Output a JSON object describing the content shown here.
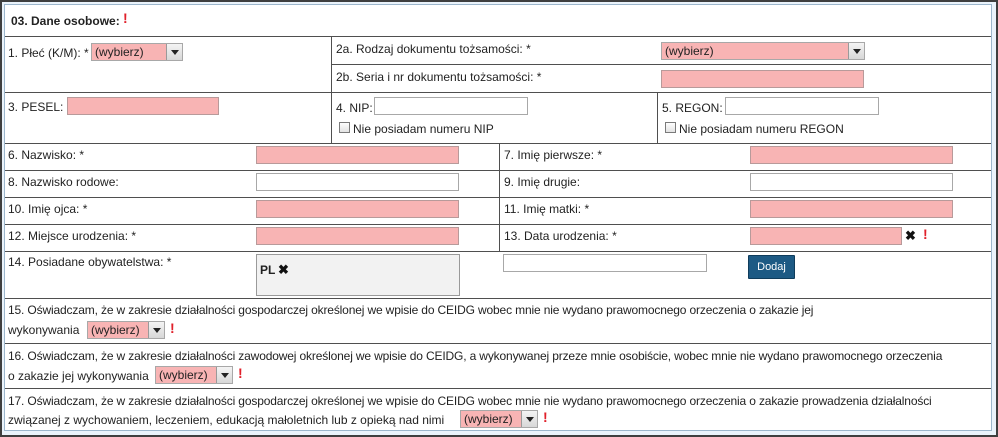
{
  "section": {
    "title": "03. Dane osobowe:",
    "required_mark": "!"
  },
  "fields": {
    "plec": {
      "label": "1. Płeć (K/M): *",
      "value": "(wybierz)"
    },
    "rodzaj_dok": {
      "label": "2a. Rodzaj dokumentu tożsamości: *",
      "value": "(wybierz)"
    },
    "seria_nr": {
      "label": "2b. Seria i nr dokumentu tożsamości: *",
      "value": ""
    },
    "pesel": {
      "label": "3. PESEL:",
      "value": ""
    },
    "nip": {
      "label": "4. NIP:",
      "value": "",
      "checkbox_label": "Nie posiadam numeru NIP"
    },
    "regon": {
      "label": "5. REGON:",
      "value": "",
      "checkbox_label": "Nie posiadam numeru REGON"
    },
    "nazwisko": {
      "label": "6. Nazwisko: *",
      "value": ""
    },
    "imie_pierwsze": {
      "label": "7. Imię pierwsze: *",
      "value": ""
    },
    "nazwisko_rodowe": {
      "label": "8. Nazwisko rodowe:",
      "value": ""
    },
    "imie_drugie": {
      "label": "9. Imię drugie:",
      "value": ""
    },
    "imie_ojca": {
      "label": "10. Imię ojca: *",
      "value": ""
    },
    "imie_matki": {
      "label": "11. Imię matki: *",
      "value": ""
    },
    "miejsce_urodzenia": {
      "label": "12. Miejsce urodzenia: *",
      "value": ""
    },
    "data_urodzenia": {
      "label": "13. Data urodzenia: *",
      "value": ""
    },
    "obywatelstwa": {
      "label": "14. Posiadane obywatelstwa: *",
      "item": "PL",
      "input_value": "",
      "add_button": "Dodaj"
    }
  },
  "statements": {
    "s15": {
      "line1": "15. Oświadczam, że w zakresie działalności gospodarczej określonej we wpisie do CEIDG wobec mnie nie wydano prawomocnego orzeczenia o zakazie jej",
      "line2": "wykonywania",
      "value": "(wybierz)"
    },
    "s16": {
      "line1": "16. Oświadczam, że w zakresie działalności zawodowej określonej we wpisie do CEIDG, a wykonywanej przeze mnie osobiście, wobec mnie nie wydano prawomocnego orzeczenia",
      "line2": "o zakazie jej wykonywania",
      "value": "(wybierz)"
    },
    "s17": {
      "line1": "17. Oświadczam, że w zakresie działalności gospodarczej określonej we wpisie do CEIDG wobec mnie nie wydano prawomocnego orzeczenia o zakazie prowadzenia działalności",
      "line2": "związanej z wychowaniem, leczeniem, edukacją małoletnich lub z opieką nad nimi",
      "value": "(wybierz)"
    }
  },
  "icons": {
    "required": "exclamation-icon",
    "remove": "close-icon"
  },
  "colors": {
    "required_field": "#f8b4b4",
    "button": "#1d5a84",
    "required_mark": "#e0202a"
  }
}
